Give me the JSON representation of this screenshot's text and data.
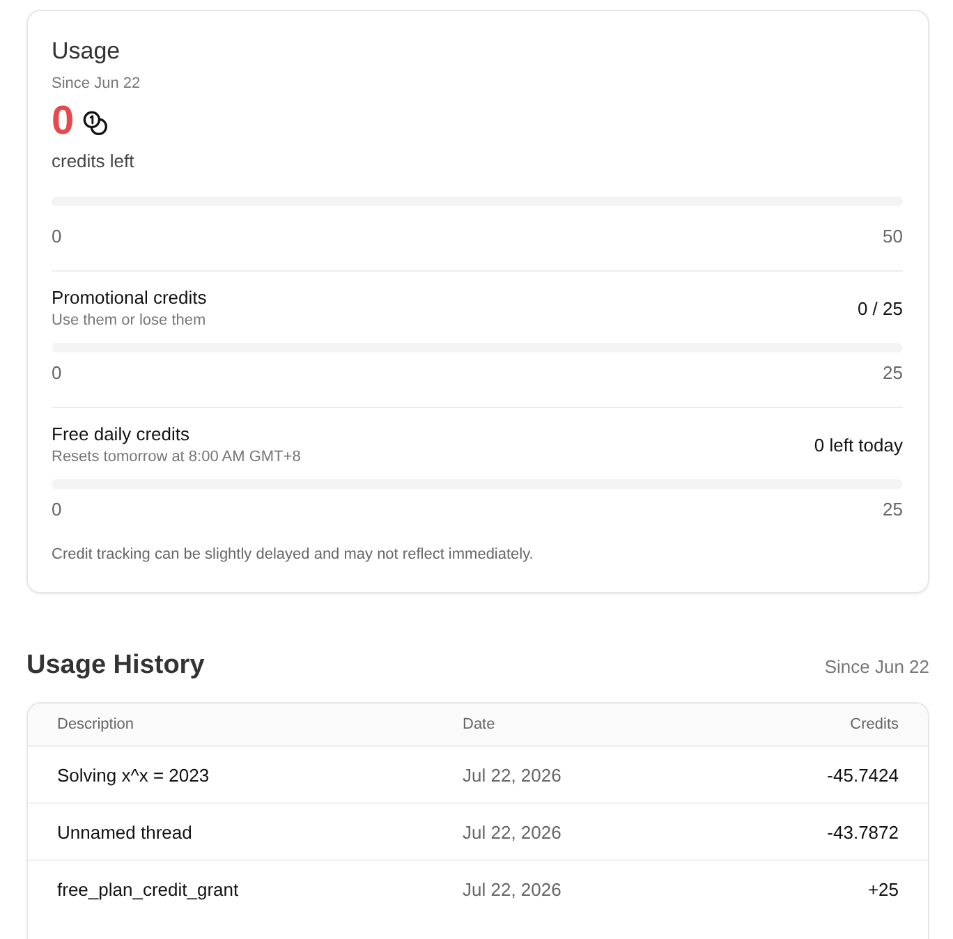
{
  "usage": {
    "title": "Usage",
    "since": "Since Jun 22",
    "credits_left": "0",
    "credits_label": "credits left",
    "bar": {
      "level": 0,
      "min_label": "0",
      "max_label": "50"
    },
    "sections": [
      {
        "title": "Promotional credits",
        "subtitle": "Use them or lose them",
        "value": "0 / 25",
        "bar": {
          "level": 0,
          "min_label": "0",
          "max_label": "25"
        }
      },
      {
        "title": "Free daily credits",
        "subtitle": "Resets tomorrow at 8:00 AM GMT+8",
        "value": "0 left today",
        "bar": {
          "level": 0,
          "min_label": "0",
          "max_label": "25"
        }
      }
    ],
    "note": "Credit tracking can be slightly delayed and may not reflect immediately."
  },
  "history": {
    "title": "Usage History",
    "since": "Since Jun 22",
    "columns": [
      "Description",
      "Date",
      "Credits"
    ],
    "rows": [
      {
        "description": "Solving x^x = 2023",
        "date": "Jul 22, 2026",
        "credits": "-45.7424"
      },
      {
        "description": "Unnamed thread",
        "date": "Jul 22, 2026",
        "credits": "-43.7872"
      },
      {
        "description": "free_plan_credit_grant",
        "date": "Jul 22, 2026",
        "credits": "+25"
      }
    ]
  }
}
